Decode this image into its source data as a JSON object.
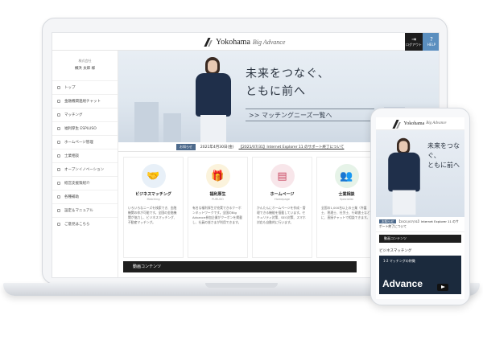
{
  "header": {
    "logo_main": "Yokohama",
    "logo_sub": "Big Advance",
    "logout_label": "ログアウト",
    "help_label": "HELP"
  },
  "sidebar": {
    "company": "株式会社",
    "user": "横浜 太郎 様",
    "items": [
      {
        "label": "トップ"
      },
      {
        "label": "金融機関連絡チャット"
      },
      {
        "label": "マッチング"
      },
      {
        "label": "福利厚生 ESPLUSO"
      },
      {
        "label": "ホームページ管理"
      },
      {
        "label": "士業相談"
      },
      {
        "label": "オープンイノベーション"
      },
      {
        "label": "経営支援策紹介"
      },
      {
        "label": "各種補助"
      },
      {
        "label": "設定＆マニュアル"
      },
      {
        "label": "ご意見はこちら"
      }
    ]
  },
  "hero": {
    "title_line1": "未来をつなぐ、",
    "title_line2": "ともに前へ",
    "button": ">> マッチングニーズ一覧へ"
  },
  "news": {
    "tag": "お知らせ",
    "date": "2021年4月30日(金)",
    "link": "【2021/07/31】Internet Explorer 11 のサポート終了について"
  },
  "cards": [
    {
      "title": "ビジネスマッチング",
      "sub": "Matching",
      "icon": "handshake-icon",
      "glyph": "🤝",
      "bg": "#e8f0f8",
      "desc": "いろいろなニーズを検索でき、金融機関の枠が可能です。全国の金融機関が協力し、ビジネスマッチング、不動産マッチング。"
    },
    {
      "title": "福利厚生",
      "sub": "PURUSO",
      "icon": "gift-icon",
      "glyph": "🎁",
      "bg": "#fbf3dc",
      "desc": "有名な福利厚生が充実できるクーポンネットワークです。全国のBig Advance参加企業がクーポンを掲載し、社員の皆さまが利用できます。"
    },
    {
      "title": "ホームページ",
      "sub": "Homepage",
      "icon": "webpage-icon",
      "glyph": "▤",
      "bg": "#f8e6ea",
      "desc": "かんたんにホームページを作成・管理できる機能を搭載しています。セキュリティ対策、SEO対策、スマホ対応も自動的に行います。"
    },
    {
      "title": "士業相談",
      "sub": "Specialist",
      "icon": "people-icon",
      "glyph": "👥",
      "bg": "#e6f3e8",
      "desc": "全国の1,000名以上の士業（弁護士、税理士、社労士、行政書士など）に、直接チャットで相談できます。"
    }
  ],
  "content_bar": "動画コンテンツ",
  "phone": {
    "news_tag": "お知らせ",
    "news_link": "【2021/07/31】Internet Explorer 11 のサポート終了について",
    "bar": "動画コンテンツ",
    "section": "ビジネスマッチング",
    "video_title": "1-2 マッチングの特徴",
    "video_word": "Advance"
  }
}
